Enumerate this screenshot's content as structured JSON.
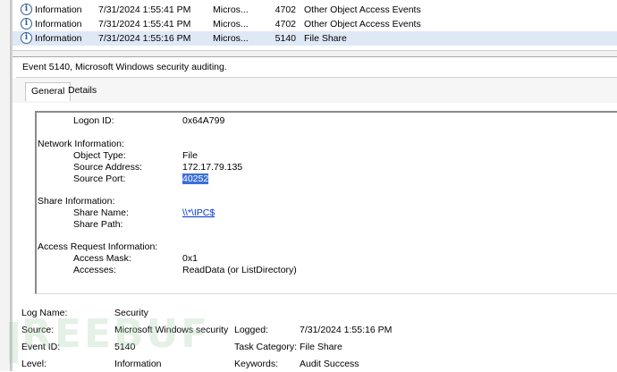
{
  "event_list": {
    "rows": [
      {
        "level": "Information",
        "date": "7/31/2024 1:55:41 PM",
        "source": "Micros...",
        "event_id": "4702",
        "category": "Other Object Access Events",
        "selected": false
      },
      {
        "level": "Information",
        "date": "7/31/2024 1:55:41 PM",
        "source": "Micros...",
        "event_id": "4702",
        "category": "Other Object Access Events",
        "selected": false
      },
      {
        "level": "Information",
        "date": "7/31/2024 1:55:16 PM",
        "source": "Micros...",
        "event_id": "5140",
        "category": "File Share",
        "selected": true
      }
    ]
  },
  "detail": {
    "title": "Event 5140, Microsoft Windows security auditing.",
    "tabs": [
      {
        "label": "General",
        "active": true
      },
      {
        "label": "Details",
        "active": false
      }
    ],
    "description": {
      "logon_id_label": "Logon ID:",
      "logon_id_value": "0x64A799",
      "network_heading": "Network Information:",
      "object_type_label": "Object Type:",
      "object_type_value": "File",
      "source_address_label": "Source Address:",
      "source_address_value": "172.17.79.135",
      "source_port_label": "Source Port:",
      "source_port_value": "40252",
      "share_heading": "Share Information:",
      "share_name_label": "Share Name:",
      "share_name_value": "\\\\*\\IPC$",
      "share_path_label": "Share Path:",
      "access_heading": "Access Request Information:",
      "access_mask_label": "Access Mask:",
      "access_mask_value": "0x1",
      "accesses_label": "Accesses:",
      "accesses_value": "ReadData (or ListDirectory)"
    },
    "properties": {
      "log_name_label": "Log Name:",
      "log_name_value": "Security",
      "source_label": "Source:",
      "source_value": "Microsoft Windows security ·",
      "logged_label": "Logged:",
      "logged_value": "7/31/2024 1:55:16 PM",
      "event_id_label": "Event ID:",
      "event_id_value": "5140",
      "task_category_label": "Task Category:",
      "task_category_value": "File Share",
      "level_label": "Level:",
      "level_value": "Information",
      "keywords_label": "Keywords:",
      "keywords_value": "Audit Success"
    }
  },
  "watermark": {
    "text": "REEBUF"
  },
  "colors": {
    "selection": "#dfe8f5",
    "highlight": "#3a6fd8",
    "link": "#0033cc",
    "info_icon": "#2f5f9a"
  },
  "icons": {
    "info": "information-icon"
  }
}
